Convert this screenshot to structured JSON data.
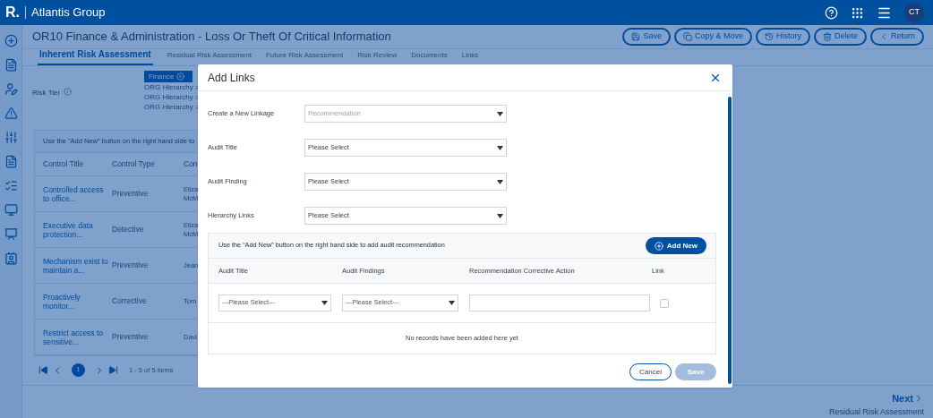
{
  "header": {
    "logo": "R.",
    "org": "Atlantis Group",
    "avatar": "CT"
  },
  "page": {
    "title": "OR10 Finance & Administration - Loss Or Theft Of Critical Information",
    "actions": [
      {
        "kind": "save",
        "label": "Save"
      },
      {
        "kind": "copy",
        "label": "Copy & Move"
      },
      {
        "kind": "history",
        "label": "History"
      },
      {
        "kind": "delete",
        "label": "Delete"
      },
      {
        "kind": "return",
        "label": "Return"
      }
    ],
    "tabs": [
      {
        "label": "Inherent Risk Assessment",
        "selected": true
      },
      {
        "label": "Residual Risk Assessment",
        "selected": false
      },
      {
        "label": "Future Risk Assessment",
        "selected": false
      },
      {
        "label": "Risk Review",
        "selected": false
      },
      {
        "label": "Documents",
        "selected": false
      },
      {
        "label": "Links",
        "selected": false
      }
    ],
    "risk_tier": "Risk Tier",
    "chip": "Finance",
    "hierarchy": [
      "ORG Hierarchy >",
      "ORG Hierarchy >",
      "ORG Hierarchy >"
    ],
    "banner": "Use the \"Add New\" button on the right hand side to",
    "table": {
      "columns": [
        "Control Title",
        "Control Type",
        "Con"
      ],
      "rows": [
        [
          "Controlled access to office...",
          "Preventive",
          "Eliza McM"
        ],
        [
          "Executive data protection...",
          "Detective",
          "Eliza McM"
        ],
        [
          "Mechanism exist to maintain a...",
          "Preventive",
          "Jean"
        ],
        [
          "Proactively monitor...",
          "Corrective",
          "Tom"
        ],
        [
          "Restrict access to sensitive...",
          "Preventive",
          "Davi"
        ]
      ]
    },
    "pagination": {
      "page": "1",
      "summary": "1 - 5 of 5 items"
    },
    "next": {
      "label": "Next",
      "caption": "Residual Risk Assessment"
    }
  },
  "modal": {
    "title": "Add Links",
    "fields": [
      {
        "label": "Create a New Linkage",
        "value": "Recommendation",
        "disabled": true
      },
      {
        "label": "Audit Title",
        "value": "Please Select",
        "disabled": false
      },
      {
        "label": "Audit Finding",
        "value": "Please Select",
        "disabled": false
      },
      {
        "label": "Hierarchy Links",
        "value": "Please Select",
        "disabled": false
      }
    ],
    "hint": "Use the “Add New” button on the right hand side to add audit recommendation",
    "add_button": "Add New",
    "columns": [
      "Audit Title",
      "Audit Findings",
      "Recommendation Corrective Action",
      "Link"
    ],
    "row": {
      "audit_title": "---Please Select---",
      "audit_findings": "---Please Select---",
      "link_checked": false
    },
    "empty_message": "No records have been added here yet",
    "cancel": "Cancel",
    "save": {
      "label": "Save",
      "disabled": true
    }
  }
}
